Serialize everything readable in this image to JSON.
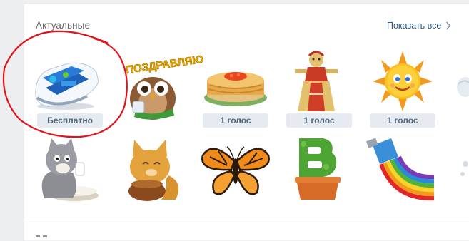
{
  "section": {
    "title": "Актуальные",
    "show_all": "Показать все"
  },
  "stickers_row1": [
    {
      "name": "sneaker",
      "price": "Бесплатно"
    },
    {
      "name": "owl-congrats",
      "banner": "ПОЗДРАВЛЯЮ"
    },
    {
      "name": "pancakes",
      "price": "1 голос"
    },
    {
      "name": "straw-doll",
      "price": "1 голос"
    },
    {
      "name": "sun",
      "price": "1 голос"
    }
  ],
  "stickers_row2": [
    {
      "name": "cat-with-milk"
    },
    {
      "name": "cat-with-pot"
    },
    {
      "name": "butterfly"
    },
    {
      "name": "letter-v-plant"
    },
    {
      "name": "rainbow-paint-tube"
    }
  ],
  "annotation": {
    "color": "#e1131c"
  },
  "colors": {
    "accent": "#2a5885",
    "badge_bg": "#e5ebf1",
    "badge_text": "#55677d"
  }
}
